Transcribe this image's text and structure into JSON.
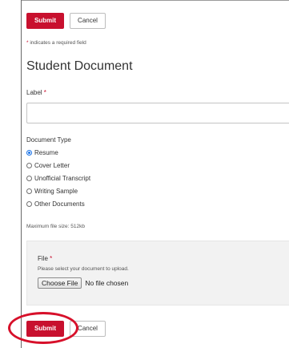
{
  "top_actions": {
    "submit_label": "Submit",
    "cancel_label": "Cancel"
  },
  "required_note": {
    "star": "*",
    "text": " indicates a required field"
  },
  "form": {
    "title": "Student Document",
    "label_field": {
      "label": "Label",
      "required_star": " *",
      "value": ""
    },
    "document_type": {
      "legend": "Document Type",
      "options": [
        {
          "label": "Resume",
          "checked": true
        },
        {
          "label": "Cover Letter",
          "checked": false
        },
        {
          "label": "Unofficial Transcript",
          "checked": false
        },
        {
          "label": "Writing Sample",
          "checked": false
        },
        {
          "label": "Other Documents",
          "checked": false
        }
      ]
    },
    "max_file_size": "Maximum file size: 512kb",
    "file_field": {
      "label": "File",
      "required_star": " *",
      "help": "Please select your document to upload.",
      "choose_label": "Choose File",
      "status": "No file chosen"
    }
  },
  "bottom_actions": {
    "submit_label": "Submit",
    "cancel_label": "Cancel"
  },
  "colors": {
    "brand_red": "#c8102e",
    "highlight": "#d7102a",
    "radio_accent": "#1a73e8"
  }
}
